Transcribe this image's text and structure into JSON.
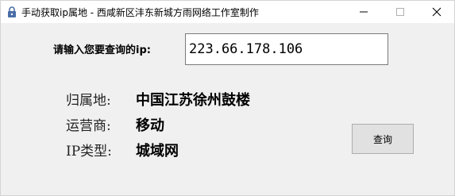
{
  "window": {
    "title": "手动获取ip属地 - 西咸新区沣东新城方雨网络工作室制作",
    "icon": "lock-icon",
    "controls": {
      "minimize_icon": "minimize-icon",
      "maximize_icon": "maximize-icon",
      "close_icon": "close-icon"
    }
  },
  "form": {
    "prompt_label": "请输入您要查询的ip:",
    "ip_value": "223.66.178.106",
    "query_button": "查询"
  },
  "results": [
    {
      "label": "归属地:",
      "value": "中国江苏徐州鼓楼"
    },
    {
      "label": "运营商:",
      "value": "移动"
    },
    {
      "label": "IP类型:",
      "value": "城域网"
    }
  ]
}
